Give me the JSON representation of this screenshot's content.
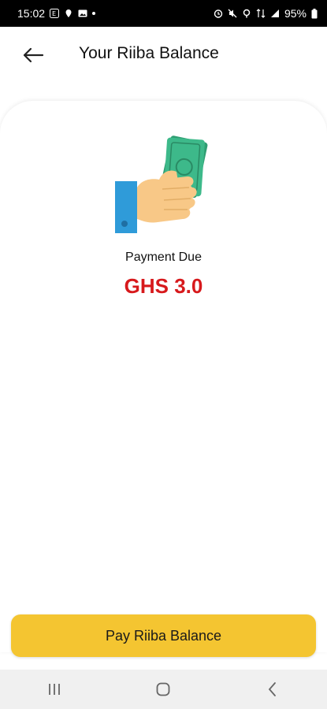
{
  "status_bar": {
    "time": "15:02",
    "battery": "95%"
  },
  "header": {
    "title": "Your Riiba Balance",
    "back_icon": "arrow-left-icon"
  },
  "balance": {
    "illustration": "hand-holding-money-icon",
    "label": "Payment Due",
    "amount": "GHS 3.0",
    "amount_color": "#d7191c"
  },
  "actions": {
    "pay_label": "Pay Riiba Balance",
    "pay_color": "#f4c531"
  },
  "nav": {
    "recents_icon": "recents-icon",
    "home_icon": "home-icon",
    "back_icon": "back-chevron-icon"
  }
}
